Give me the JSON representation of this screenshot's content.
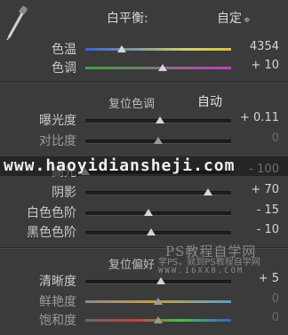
{
  "white_balance": {
    "label": "白平衡:",
    "value": "自定",
    "dropdown_arrow": "≑",
    "sliders": [
      {
        "label": "色温",
        "value": "4354",
        "position": 0.25,
        "track": "temp"
      },
      {
        "label": "色调",
        "value": "+ 10",
        "position": 0.53,
        "track": "tint"
      }
    ]
  },
  "tone": {
    "reset_label": "复位色调",
    "auto_label": "自动",
    "sliders": [
      {
        "label": "曝光度",
        "value": "+ 0.11",
        "position": 0.51,
        "dim": false
      },
      {
        "label": "对比度",
        "value": "0",
        "position": 0.5,
        "dim": true
      },
      {
        "label": "高光",
        "value": "- 100",
        "position": 0.0,
        "dim": false
      },
      {
        "label": "阴影",
        "value": "+ 70",
        "position": 0.84,
        "dim": false
      },
      {
        "label": "白色色阶",
        "value": "- 15",
        "position": 0.43,
        "dim": false
      },
      {
        "label": "黑色色阶",
        "value": "- 10",
        "position": 0.45,
        "dim": false
      }
    ]
  },
  "presence": {
    "reset_label": "复位偏好",
    "sliders": [
      {
        "label": "清晰度",
        "value": "+ 5",
        "position": 0.52,
        "dim": false,
        "track": "plain"
      },
      {
        "label": "鲜艳度",
        "value": "0",
        "position": 0.5,
        "dim": true,
        "track": "vib"
      },
      {
        "label": "饱和度",
        "value": "0",
        "position": 0.5,
        "dim": true,
        "track": "sat"
      }
    ]
  },
  "watermarks": {
    "main": "www.haoyidiansheji.com",
    "ps": "PS教程自学网",
    "sub1": "学PS，就到PS教程自学网",
    "sub2": "WWW.16XX8.COM"
  },
  "colors": {
    "panel_bg": "#3b3b3b",
    "thumb": "#d6d6d6"
  }
}
